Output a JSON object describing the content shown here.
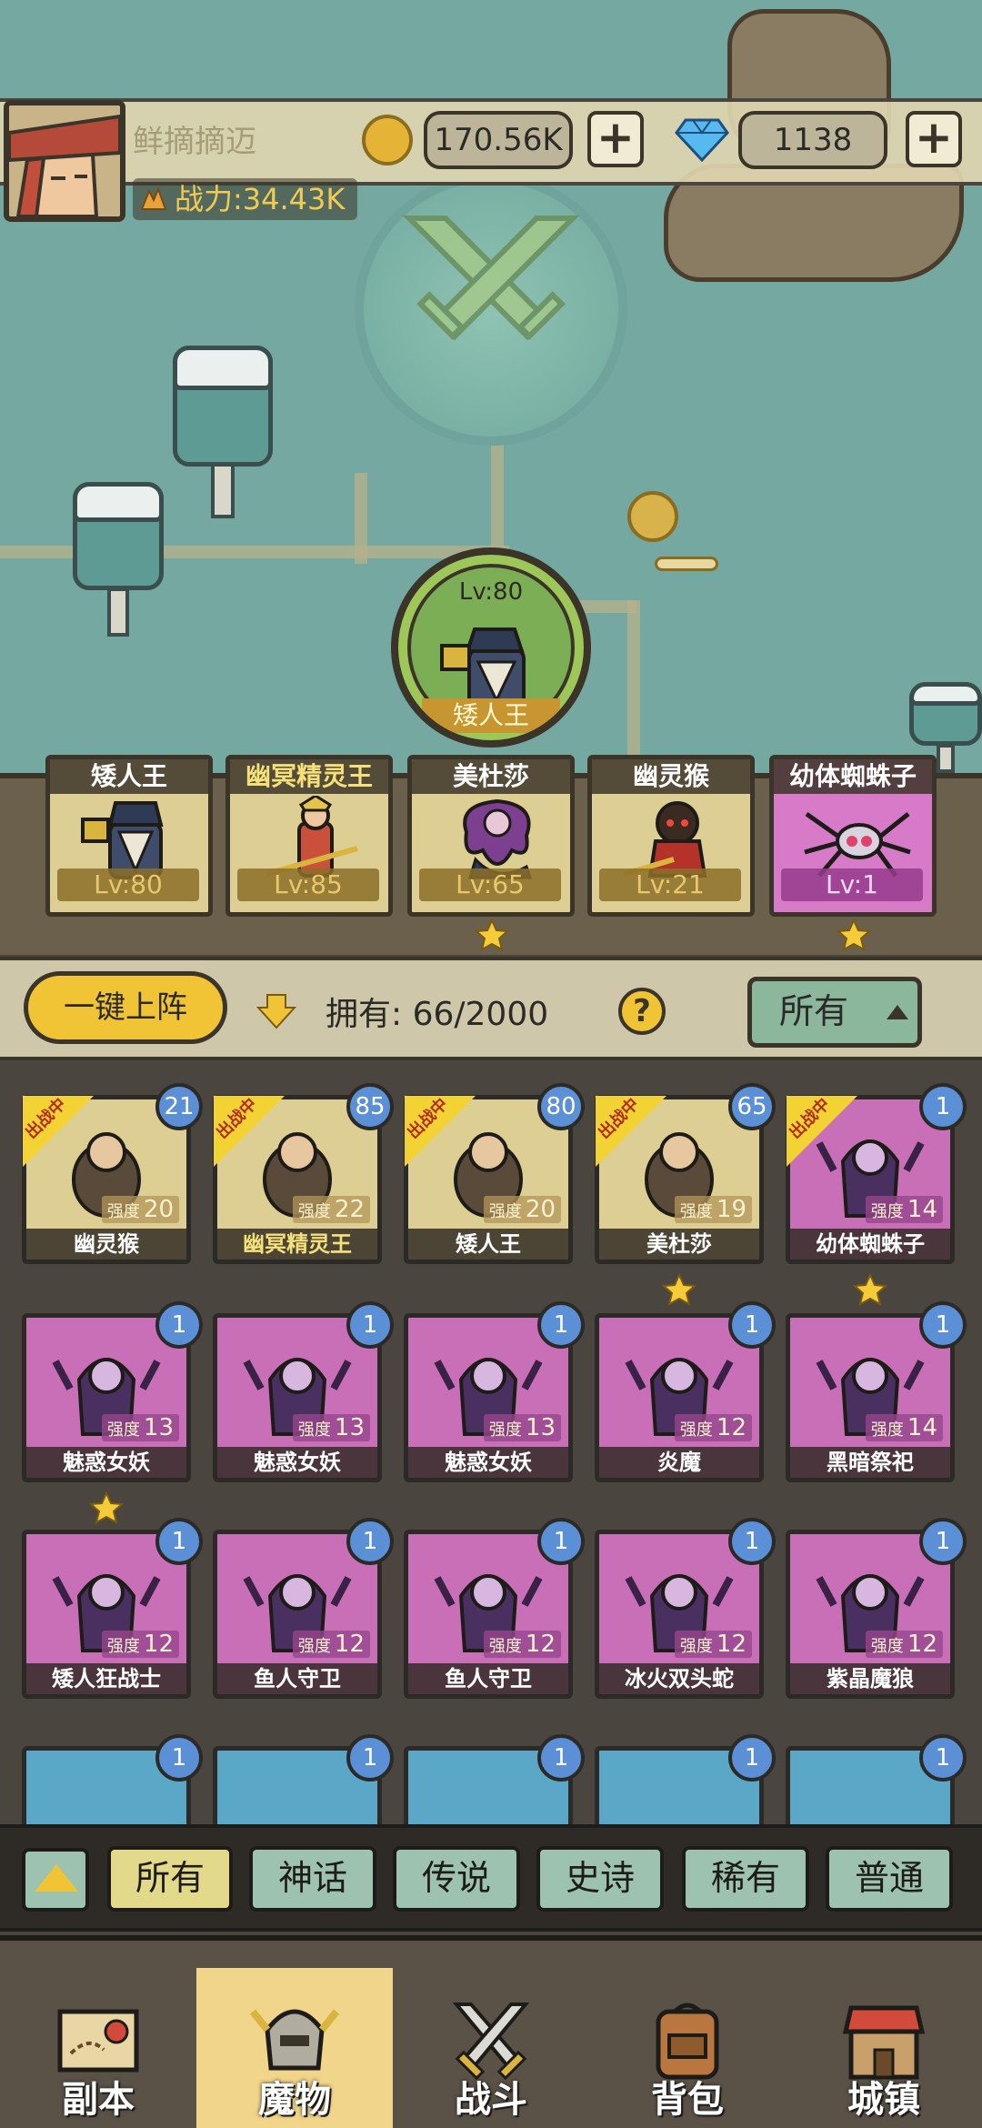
{
  "player": {
    "name": "鲜摘摘迈",
    "power": "战力:34.43K"
  },
  "resources": {
    "gold": "170.56K",
    "gems": "1138",
    "plus": "+"
  },
  "selected_hero": {
    "level": "Lv:80",
    "name": "矮人王"
  },
  "lineup": [
    {
      "name": "矮人王",
      "level": "Lv:80",
      "rarity": "legend"
    },
    {
      "name": "幽冥精灵王",
      "level": "Lv:85",
      "rarity": "legend"
    },
    {
      "name": "美杜莎",
      "level": "Lv:65",
      "rarity": "legend",
      "starred": true
    },
    {
      "name": "幽灵猴",
      "level": "Lv:21",
      "rarity": "legend"
    },
    {
      "name": "幼体蜘蛛子",
      "level": "Lv:1",
      "rarity": "epic",
      "starred": true
    }
  ],
  "toolbar": {
    "auto_deploy": "一键上阵",
    "owned": "拥有:  66/2000",
    "help": "?",
    "filter": "所有"
  },
  "monsters": [
    {
      "name": "幽灵猴",
      "count": "21",
      "strength_label": "强度",
      "strength": "20",
      "deployed": true,
      "color": "gold"
    },
    {
      "name": "幽冥精灵王",
      "count": "85",
      "strength_label": "强度",
      "strength": "22",
      "deployed": true,
      "color": "gold",
      "name_highlight": true
    },
    {
      "name": "矮人王",
      "count": "80",
      "strength_label": "强度",
      "strength": "20",
      "deployed": true,
      "color": "gold"
    },
    {
      "name": "美杜莎",
      "count": "65",
      "strength_label": "强度",
      "strength": "19",
      "deployed": true,
      "color": "gold",
      "starred": true
    },
    {
      "name": "幼体蜘蛛子",
      "count": "1",
      "strength_label": "强度",
      "strength": "14",
      "deployed": true,
      "color": "purple",
      "starred": true
    },
    {
      "name": "魅惑女妖",
      "count": "1",
      "strength_label": "强度",
      "strength": "13",
      "color": "purple",
      "starred": true
    },
    {
      "name": "魅惑女妖",
      "count": "1",
      "strength_label": "强度",
      "strength": "13",
      "color": "purple"
    },
    {
      "name": "魅惑女妖",
      "count": "1",
      "strength_label": "强度",
      "strength": "13",
      "color": "purple"
    },
    {
      "name": "炎魔",
      "count": "1",
      "strength_label": "强度",
      "strength": "12",
      "color": "purple"
    },
    {
      "name": "黑暗祭祀",
      "count": "1",
      "strength_label": "强度",
      "strength": "14",
      "color": "purple"
    },
    {
      "name": "矮人狂战士",
      "count": "1",
      "strength_label": "强度",
      "strength": "12",
      "color": "purple"
    },
    {
      "name": "鱼人守卫",
      "count": "1",
      "strength_label": "强度",
      "strength": "12",
      "color": "purple"
    },
    {
      "name": "鱼人守卫",
      "count": "1",
      "strength_label": "强度",
      "strength": "12",
      "color": "purple"
    },
    {
      "name": "冰火双头蛇",
      "count": "1",
      "strength_label": "强度",
      "strength": "12",
      "color": "purple"
    },
    {
      "name": "紫晶魔狼",
      "count": "1",
      "strength_label": "强度",
      "strength": "12",
      "color": "purple"
    },
    {
      "count": "1",
      "color": "blue"
    },
    {
      "count": "1",
      "color": "blue"
    },
    {
      "count": "1",
      "color": "blue"
    },
    {
      "count": "1",
      "color": "blue"
    },
    {
      "count": "1",
      "color": "blue"
    }
  ],
  "deployed_label": "出战中",
  "rarity_tabs": [
    "所有",
    "神话",
    "传说",
    "史诗",
    "稀有",
    "普通"
  ],
  "nav": [
    "副本",
    "魔物",
    "战斗",
    "背包",
    "城镇"
  ],
  "colors": {
    "gold_card": "#ddcf93",
    "purple_card": "#c96fb8",
    "blue_card": "#5aa7c7",
    "accent": "#f1c436"
  }
}
